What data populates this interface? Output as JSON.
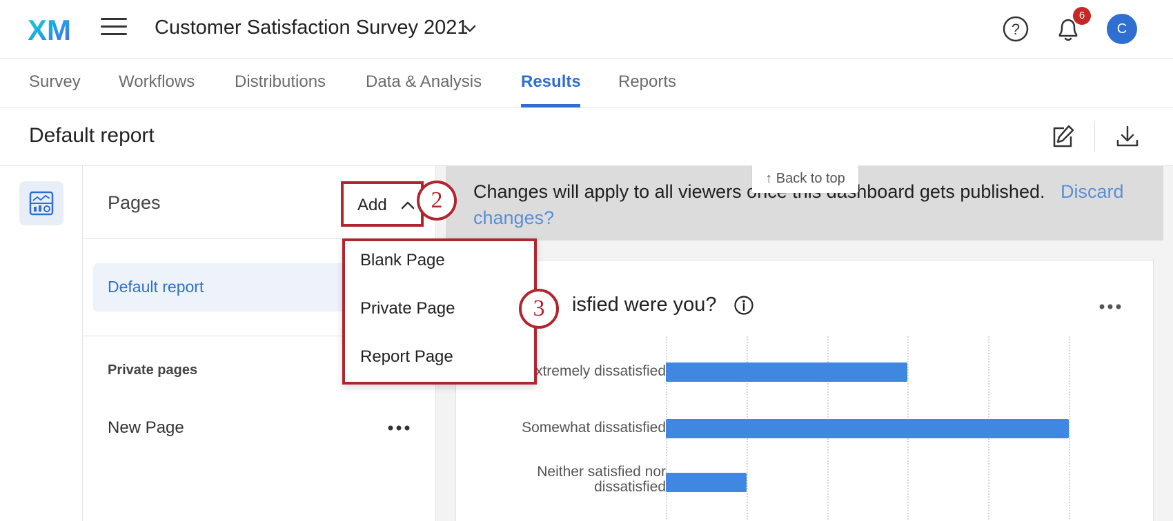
{
  "header": {
    "logo_text": "XM",
    "survey_title": "Customer Satisfaction Survey 2021",
    "notification_count": "6",
    "avatar_initial": "C"
  },
  "tabs": [
    {
      "label": "Survey"
    },
    {
      "label": "Workflows"
    },
    {
      "label": "Distributions"
    },
    {
      "label": "Data & Analysis"
    },
    {
      "label": "Results",
      "active": true
    },
    {
      "label": "Reports"
    }
  ],
  "report": {
    "title": "Default report"
  },
  "pages_panel": {
    "label": "Pages",
    "add_button": "Add",
    "active_page": "Default report",
    "private_section": "Private pages",
    "private_pages": [
      "New Page"
    ]
  },
  "dropdown": {
    "items": [
      "Blank Page",
      "Private Page",
      "Report Page"
    ]
  },
  "notice": {
    "text": "Changes will apply to all viewers once this dashboard gets published.",
    "link": "Discard changes?",
    "back_to_top": "↑ Back to top"
  },
  "widget": {
    "title": "How satisfied were you?",
    "visible_title_fragment": "isfied were you?"
  },
  "chart_data": {
    "type": "bar",
    "orientation": "horizontal",
    "categories": [
      "Extremely dissatisfied",
      "Somewhat dissatisfied",
      "Neither satisfied nor dissatisfied"
    ],
    "visible_labels": [
      "xtremely dissatisfied",
      "Somewhat dissatisfied",
      "Neither satisfied nor",
      "dissatisfied"
    ],
    "values": [
      3,
      5,
      1
    ],
    "xlim": [
      0,
      5
    ],
    "grid": true
  },
  "steps": [
    "2",
    "3"
  ],
  "colors": {
    "accent": "#2e6fd1",
    "bar": "#3f87e0",
    "annotation": "#b0262e",
    "badge": "#c62828"
  }
}
